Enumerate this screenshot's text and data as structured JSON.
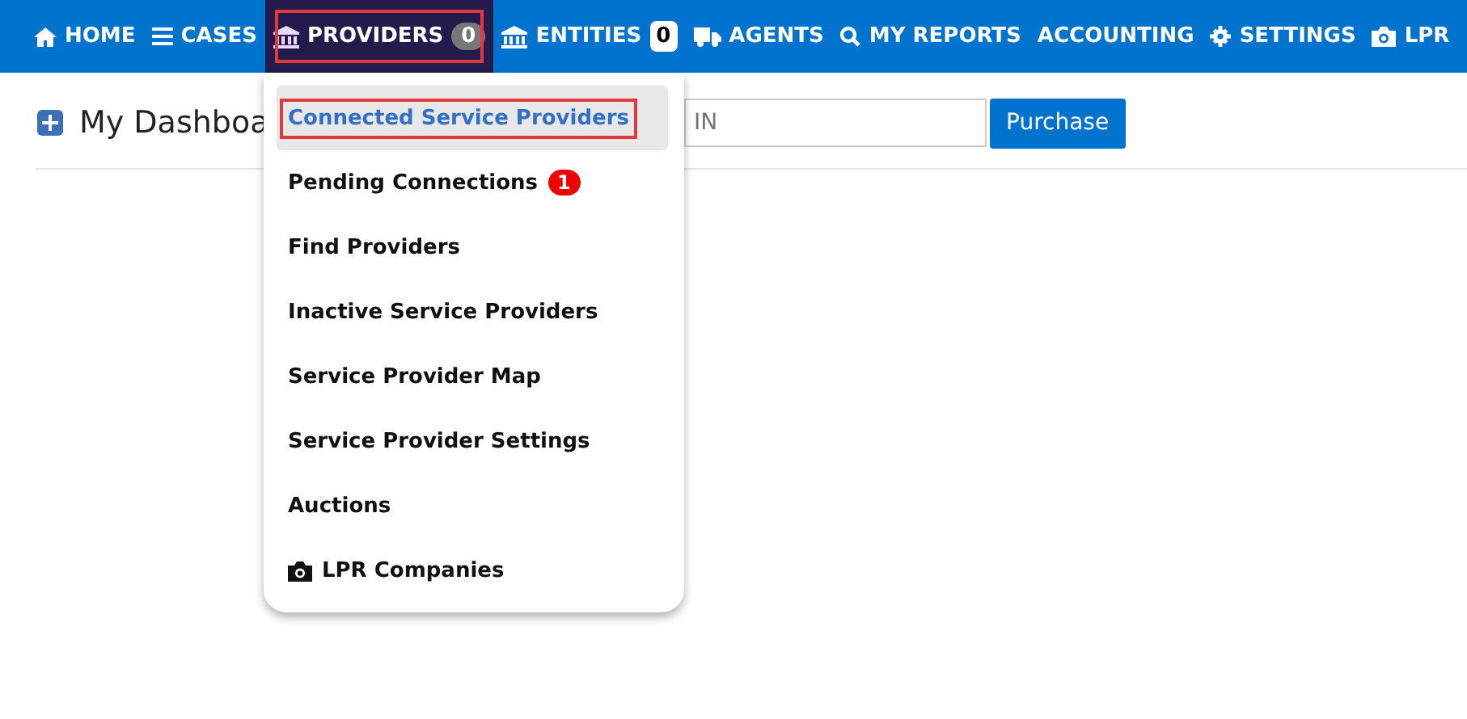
{
  "nav": [
    {
      "label": "HOME",
      "kind": "home",
      "selected": false,
      "highlighted": false
    },
    {
      "label": "CASES",
      "kind": "bars",
      "selected": false,
      "highlighted": false
    },
    {
      "label": "PROVIDERS",
      "kind": "bank",
      "selected": true,
      "highlighted": true,
      "badge": "0"
    },
    {
      "label": "ENTITIES",
      "kind": "bank",
      "selected": false,
      "highlighted": false,
      "badge": "0"
    },
    {
      "label": "AGENTS",
      "kind": "truck",
      "selected": false,
      "highlighted": false
    },
    {
      "label": "MY REPORTS",
      "kind": "search",
      "selected": false,
      "highlighted": false
    },
    {
      "label": "ACCOUNTING",
      "kind": "plain",
      "selected": false,
      "highlighted": false
    },
    {
      "label": "SETTINGS",
      "kind": "gear",
      "selected": false,
      "highlighted": false
    },
    {
      "label": "LPR",
      "kind": "camera",
      "selected": false,
      "highlighted": false
    }
  ],
  "dashboard": {
    "title": "My Dashboa",
    "vin_placeholder": "IN",
    "purchase": "Purchase"
  },
  "menu": [
    {
      "label": "Connected Service Providers",
      "kind": "plain",
      "selected": true,
      "highlighted": true
    },
    {
      "label": "Pending Connections",
      "kind": "plain",
      "selected": false,
      "highlighted": false,
      "badge": "1"
    },
    {
      "label": "Find Providers",
      "kind": "plain",
      "selected": false,
      "highlighted": false
    },
    {
      "label": "Inactive Service Providers",
      "kind": "plain",
      "selected": false,
      "highlighted": false
    },
    {
      "label": "Service Provider Map",
      "kind": "plain",
      "selected": false,
      "highlighted": false
    },
    {
      "label": "Service Provider Settings",
      "kind": "plain",
      "selected": false,
      "highlighted": false
    },
    {
      "label": "Auctions",
      "kind": "plain",
      "selected": false,
      "highlighted": false
    },
    {
      "label": "LPR Companies",
      "kind": "camera",
      "selected": false,
      "highlighted": false
    }
  ]
}
